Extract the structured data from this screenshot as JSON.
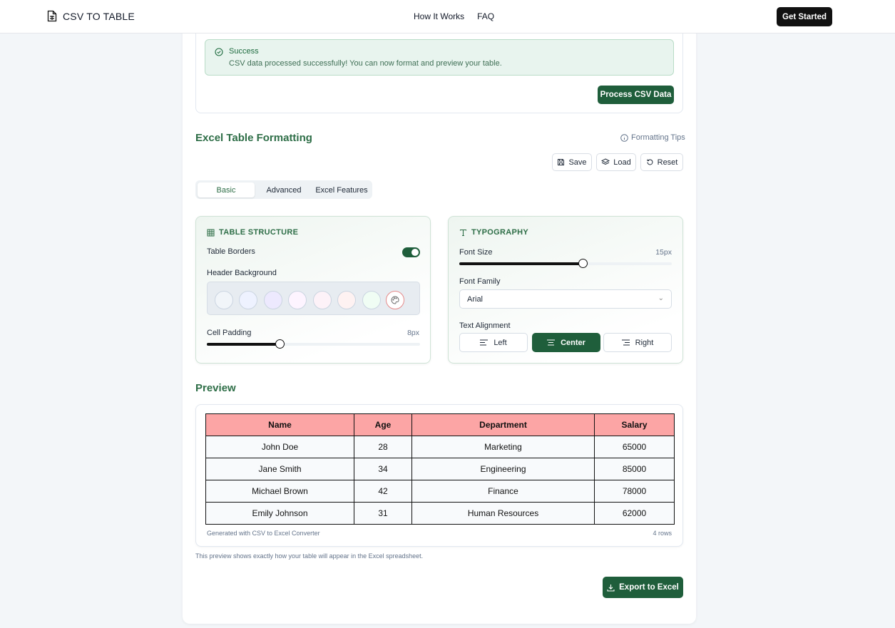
{
  "nav": {
    "brand": "CSV TO TABLE",
    "links": [
      "How It Works",
      "FAQ"
    ],
    "cta": "Get Started"
  },
  "alert": {
    "title": "Success",
    "message": "CSV data processed successfully! You can now format and preview your table."
  },
  "process_button": "Process CSV Data",
  "formatting": {
    "title": "Excel Table Formatting",
    "tips": "Formatting Tips",
    "actions": {
      "save": "Save",
      "load": "Load",
      "reset": "Reset"
    },
    "tabs": [
      "Basic",
      "Advanced",
      "Excel Features"
    ],
    "active_tab": "Basic",
    "structure": {
      "heading": "TABLE STRUCTURE",
      "borders_label": "Table Borders",
      "borders_on": true,
      "header_bg_label": "Header Background",
      "swatches": [
        "#f1f5f9",
        "#eef2ff",
        "#ede9fe",
        "#fdf4ff",
        "#fdf2f8",
        "#fef2f2",
        "#f0fdf4"
      ],
      "padding_label": "Cell Padding",
      "padding_value": "8px",
      "padding_fraction": 0.34
    },
    "typography": {
      "heading": "TYPOGRAPHY",
      "font_size_label": "Font Size",
      "font_size_value": "15px",
      "font_size_fraction": 0.58,
      "font_family_label": "Font Family",
      "font_family_value": "Arial",
      "alignment_label": "Text Alignment",
      "alignments": [
        "Left",
        "Center",
        "Right"
      ],
      "active_alignment": "Center"
    }
  },
  "preview": {
    "title": "Preview",
    "header_color": "#fca5a5",
    "columns": [
      "Name",
      "Age",
      "Department",
      "Salary"
    ],
    "rows": [
      [
        "John Doe",
        "28",
        "Marketing",
        "65000"
      ],
      [
        "Jane Smith",
        "34",
        "Engineering",
        "85000"
      ],
      [
        "Michael Brown",
        "42",
        "Finance",
        "78000"
      ],
      [
        "Emily Johnson",
        "31",
        "Human Resources",
        "62000"
      ]
    ],
    "footer_left": "Generated with CSV to Excel Converter",
    "footer_right": "4 rows",
    "note": "This preview shows exactly how your table will appear in the Excel spreadsheet."
  },
  "export_button": "Export to Excel",
  "colors": {
    "accent": "#1f5e3b",
    "accent_text": "#2e6e47"
  }
}
